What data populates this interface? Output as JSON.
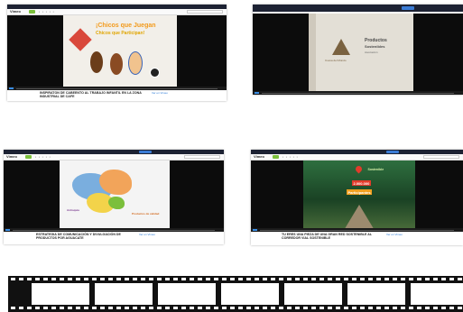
{
  "screenshots": [
    {
      "logo_label": "Vimeo",
      "caption": "Inspiraton de Cabeento al Trabajo Infantil en la Zona Industrial de Cafe",
      "frame_title_line1": "¡Chicos que Juegan",
      "frame_title_line2": "Chicos que Participan!",
      "meta_line": "Ver en Vimeo"
    },
    {
      "logo_label": "",
      "caption": "",
      "frame_brand": "Cueva del Mundo",
      "frame_title_line1": "Productos",
      "frame_title_line2": "Sostenibles",
      "frame_subtitle": "Asociación",
      "meta_line": ""
    },
    {
      "logo_label": "Vimeo",
      "caption": "Estrategia de Comunicación y Divulgación de Productos por Aguacate",
      "frame_label_line1": "Antioquia",
      "frame_label_line2": "Productos de calidad",
      "meta_line": "Ver en Vimeo"
    },
    {
      "logo_label": "Vimeo",
      "caption": "Tu Eres una Pieza de una Gran Red Sostenible al Corredor Vial Sostenible",
      "frame_badge_1": "2.000.000",
      "frame_badge_2": "Participantes",
      "frame_top_text": "Sostenible",
      "meta_line": "Ver en Vimeo"
    }
  ],
  "filmstrip": {
    "frames": 7
  },
  "colors": {
    "topbar": "#1d2233",
    "accent_blue": "#3a7bd5",
    "vimeo_green": "#7bbf3c"
  }
}
